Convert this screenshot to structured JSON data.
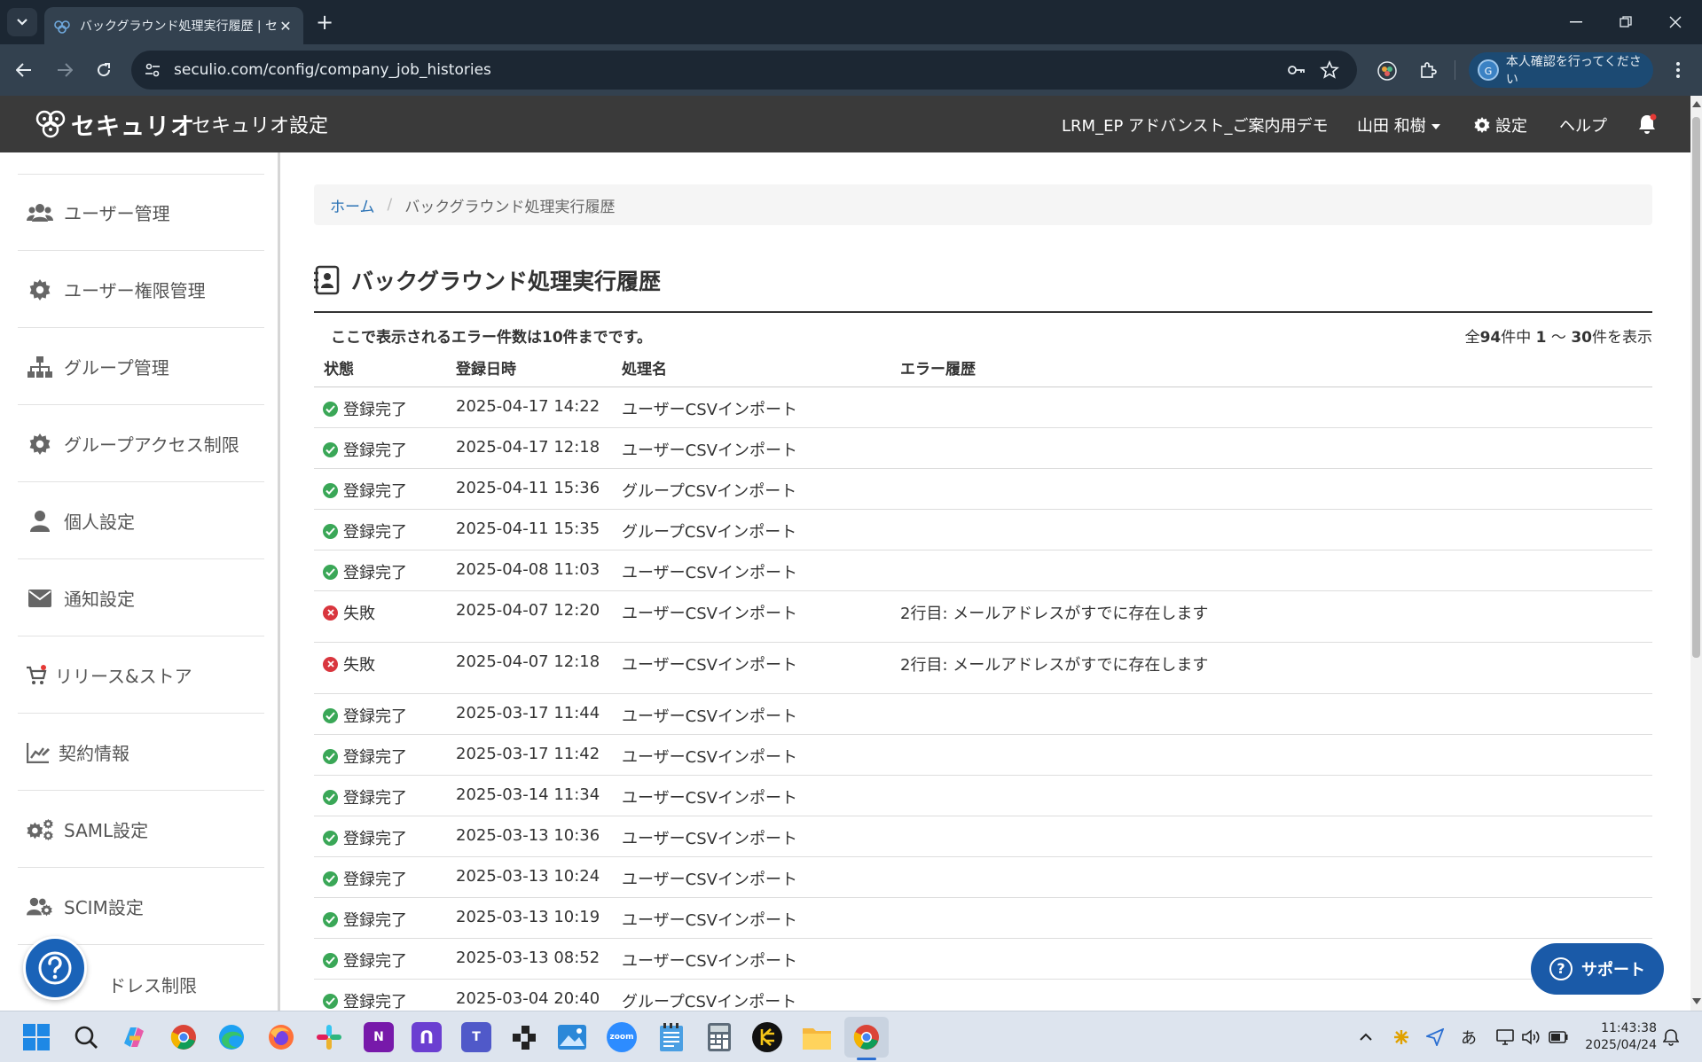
{
  "browser": {
    "tab_title": "バックグラウンド処理実行履歴 | セキ",
    "url": "seculio.com/config/company_job_histories",
    "profile_label": "本人確認を行ってください",
    "profile_initial": "G"
  },
  "header": {
    "logo_text": "セキュリオ",
    "app_title": "セキュリオ設定",
    "org_name": "LRM_EP アドバンスト_ご案内用デモ",
    "user_name": "山田 和樹",
    "settings_label": "設定",
    "help_label": "ヘルプ"
  },
  "sidebar": {
    "items": [
      {
        "label": "ユーザー管理",
        "icon": "users-icon"
      },
      {
        "label": "ユーザー権限管理",
        "icon": "gear-icon"
      },
      {
        "label": "グループ管理",
        "icon": "sitemap-icon"
      },
      {
        "label": "グループアクセス制限",
        "icon": "gear-icon"
      },
      {
        "label": "個人設定",
        "icon": "user-icon"
      },
      {
        "label": "通知設定",
        "icon": "envelope-icon"
      },
      {
        "label": "リリース&ストア",
        "icon": "cart-icon"
      },
      {
        "label": "契約情報",
        "icon": "chart-edit-icon"
      },
      {
        "label": "SAML設定",
        "icon": "gears-icon"
      },
      {
        "label": "SCIM設定",
        "icon": "users-gear-icon"
      },
      {
        "label": "ドレス制限",
        "icon": "ip-icon"
      }
    ]
  },
  "breadcrumb": {
    "home": "ホーム",
    "separator": "/",
    "current": "バックグラウンド処理実行履歴"
  },
  "page": {
    "title": "バックグラウンド処理実行履歴",
    "notice": "ここで表示されるエラー件数は10件までです。",
    "count_prefix": "全",
    "count_total": "94",
    "count_mid": "件中 ",
    "count_from": "1",
    "count_tilde": " ～ ",
    "count_to": "30",
    "count_suffix": "件を表示"
  },
  "table": {
    "headers": {
      "status": "状態",
      "date": "登録日時",
      "job": "処理名",
      "error": "エラー履歴"
    },
    "rows": [
      {
        "status": "登録完了",
        "ok": true,
        "date": "2025-04-17 14:22",
        "job": "ユーザーCSVインポート",
        "error": ""
      },
      {
        "status": "登録完了",
        "ok": true,
        "date": "2025-04-17 12:18",
        "job": "ユーザーCSVインポート",
        "error": ""
      },
      {
        "status": "登録完了",
        "ok": true,
        "date": "2025-04-11 15:36",
        "job": "グループCSVインポート",
        "error": ""
      },
      {
        "status": "登録完了",
        "ok": true,
        "date": "2025-04-11 15:35",
        "job": "グループCSVインポート",
        "error": ""
      },
      {
        "status": "登録完了",
        "ok": true,
        "date": "2025-04-08 11:03",
        "job": "ユーザーCSVインポート",
        "error": ""
      },
      {
        "status": "失敗",
        "ok": false,
        "date": "2025-04-07 12:20",
        "job": "ユーザーCSVインポート",
        "error": "2行目: メールアドレスがすでに存在します"
      },
      {
        "status": "失敗",
        "ok": false,
        "date": "2025-04-07 12:18",
        "job": "ユーザーCSVインポート",
        "error": "2行目: メールアドレスがすでに存在します"
      },
      {
        "status": "登録完了",
        "ok": true,
        "date": "2025-03-17 11:44",
        "job": "ユーザーCSVインポート",
        "error": ""
      },
      {
        "status": "登録完了",
        "ok": true,
        "date": "2025-03-17 11:42",
        "job": "ユーザーCSVインポート",
        "error": ""
      },
      {
        "status": "登録完了",
        "ok": true,
        "date": "2025-03-14 11:34",
        "job": "ユーザーCSVインポート",
        "error": ""
      },
      {
        "status": "登録完了",
        "ok": true,
        "date": "2025-03-13 10:36",
        "job": "ユーザーCSVインポート",
        "error": ""
      },
      {
        "status": "登録完了",
        "ok": true,
        "date": "2025-03-13 10:24",
        "job": "ユーザーCSVインポート",
        "error": ""
      },
      {
        "status": "登録完了",
        "ok": true,
        "date": "2025-03-13 10:19",
        "job": "ユーザーCSVインポート",
        "error": ""
      },
      {
        "status": "登録完了",
        "ok": true,
        "date": "2025-03-13 08:52",
        "job": "ユーザーCSVインポート",
        "error": ""
      },
      {
        "status": "登録完了",
        "ok": true,
        "date": "2025-03-04 20:40",
        "job": "グループCSVインポート",
        "error": ""
      }
    ]
  },
  "support": {
    "label": "サポート"
  },
  "taskbar": {
    "clock_time": "11:43:38",
    "clock_date": "2025/04/24",
    "ime": "あ"
  },
  "colors": {
    "header_bg": "#3a3a3a",
    "link": "#2a72b5",
    "success": "#3aa757",
    "failure": "#d9363e",
    "support_bg": "#1a5aa8"
  }
}
